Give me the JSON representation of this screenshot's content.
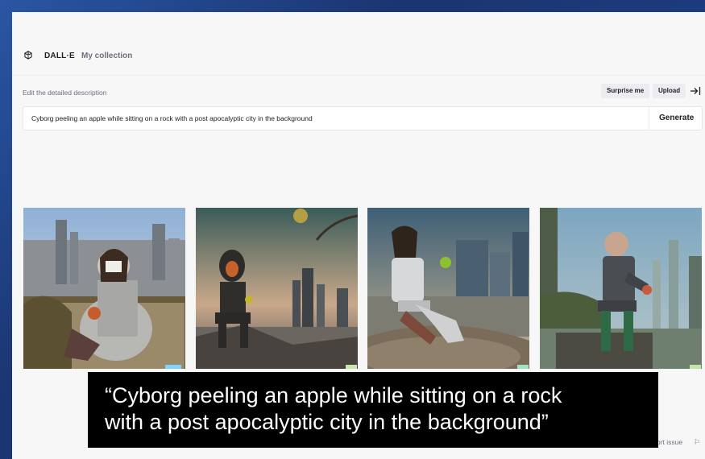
{
  "nav": {
    "brand": "DALL·E",
    "link": "My collection",
    "logo_icon": "openai-logo-icon"
  },
  "editor": {
    "label": "Edit the detailed description",
    "surprise_label": "Surprise me",
    "upload_label": "Upload",
    "collapse_icon": "sidebar-collapse-icon",
    "prompt": "Cyborg peeling an apple while sitting on a rock with a post apocalyptic city in the background",
    "generate_label": "Generate"
  },
  "footer": {
    "report_label": "ort issue",
    "flag_icon": "flag-icon"
  },
  "caption": {
    "line1": "“Cyborg peeling an apple while sitting on a rock",
    "line2": "with a post apocalyptic city in the background”"
  },
  "colors": {
    "page_bg": "#f7f7f8",
    "text": "#202123",
    "muted": "#6e6e80",
    "slide_bg": "#1f3f7a"
  }
}
